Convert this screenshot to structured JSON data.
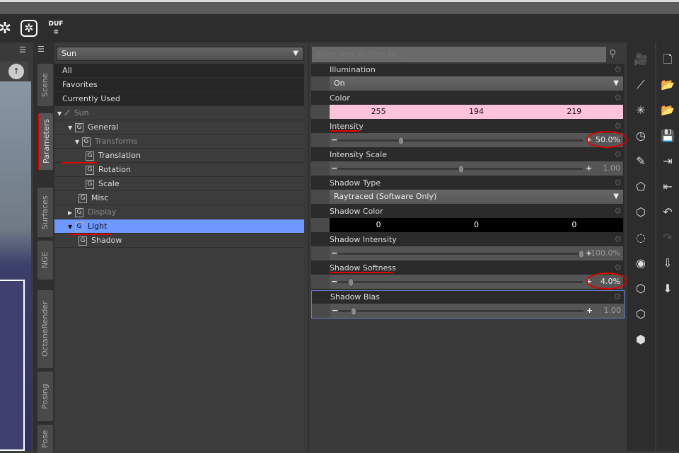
{
  "toolbar": {
    "icons": [
      "octane-icon",
      "octane-render-icon",
      "duf-icon"
    ],
    "duf_label": "DUF"
  },
  "tabs": [
    "Scene",
    "Parameters",
    "Surfaces",
    "NGE",
    "OctaneRender",
    "Posing",
    "Pose"
  ],
  "tree": {
    "selector": "Sun",
    "items": [
      {
        "label": "All"
      },
      {
        "label": "Favorites"
      },
      {
        "label": "Currently Used"
      },
      {
        "label": "Sun"
      },
      {
        "label": "General"
      },
      {
        "label": "Transforms"
      },
      {
        "label": "Translation"
      },
      {
        "label": "Rotation"
      },
      {
        "label": "Scale"
      },
      {
        "label": "Misc"
      },
      {
        "label": "Display"
      },
      {
        "label": "Light"
      },
      {
        "label": "Shadow"
      }
    ]
  },
  "params": {
    "filter_placeholder": "Enter text to filter by...",
    "rows": [
      {
        "label": "Illumination",
        "type": "dropdown",
        "value": "On"
      },
      {
        "label": "Color",
        "type": "color",
        "values": [
          "255",
          "194",
          "219"
        ],
        "color": "#ffc2db"
      },
      {
        "label": "Intensity",
        "type": "slider",
        "value": "50.0%",
        "fraction": 0.25
      },
      {
        "label": "Intensity Scale",
        "type": "slider",
        "value": "1.00",
        "fraction": 0.5
      },
      {
        "label": "Shadow Type",
        "type": "dropdown",
        "value": "Raytraced (Software Only)"
      },
      {
        "label": "Shadow Color",
        "type": "color",
        "values": [
          "0",
          "0",
          "0"
        ],
        "color": "#000000"
      },
      {
        "label": "Shadow Intensity",
        "type": "slider",
        "value": "100.0%",
        "fraction": 1.0
      },
      {
        "label": "Shadow Softness",
        "type": "slider",
        "value": "4.0%",
        "fraction": 0.04
      },
      {
        "label": "Shadow Bias",
        "type": "slider",
        "value": "1.00",
        "fraction": 0.05
      }
    ]
  },
  "accent": "#6f99ff"
}
